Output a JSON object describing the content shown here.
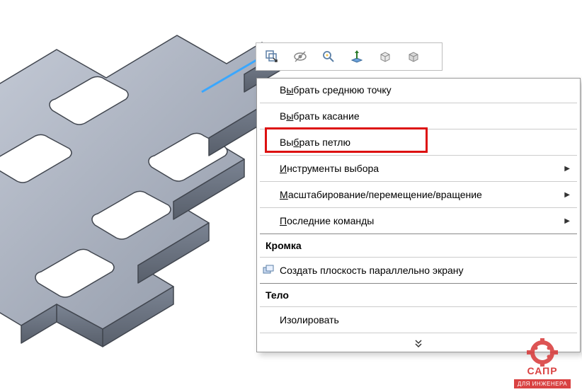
{
  "toolbar": {
    "icons": [
      {
        "name": "select-other-icon"
      },
      {
        "name": "hide-show-icon"
      },
      {
        "name": "zoom-to-fit-icon"
      },
      {
        "name": "normal-to-icon"
      },
      {
        "name": "appearance-icon"
      },
      {
        "name": "scene-icon"
      }
    ]
  },
  "context_menu": {
    "items": [
      {
        "id": "select-midpoint",
        "label_pre": "В",
        "mnemonic": "ы",
        "label_post": "брать среднюю точку",
        "submenu": false
      },
      {
        "id": "select-tangency",
        "label_pre": "В",
        "mnemonic": "ы",
        "label_post": "брать касание",
        "submenu": false
      },
      {
        "id": "select-loop",
        "label_pre": "Вы",
        "mnemonic": "б",
        "label_post": "рать петлю",
        "submenu": false,
        "highlighted": true
      },
      {
        "id": "selection-tools",
        "label_pre": "",
        "mnemonic": "И",
        "label_post": "нструменты выбора",
        "submenu": true
      },
      {
        "id": "zoom-pan-rotate",
        "label_pre": "",
        "mnemonic": "М",
        "label_post": "асштабирование/перемещение/вращение",
        "submenu": true
      },
      {
        "id": "recent-commands",
        "label_pre": "",
        "mnemonic": "П",
        "label_post": "оследние команды",
        "submenu": true
      }
    ],
    "section_edge": "Кромка",
    "edge_items": [
      {
        "id": "create-plane-parallel",
        "label": "Создать плоскость параллельно экрану",
        "icon": "plane-icon"
      }
    ],
    "section_body": "Тело",
    "body_items": [
      {
        "id": "isolate",
        "label": "Изолировать"
      }
    ]
  },
  "watermark": {
    "line1": "САПР",
    "line2": "ДЛЯ ИНЖЕНЕРА"
  },
  "colors": {
    "highlight_edge": "#3aa7ff",
    "part_face": "#9ea6b4",
    "part_edge": "#41464f"
  }
}
